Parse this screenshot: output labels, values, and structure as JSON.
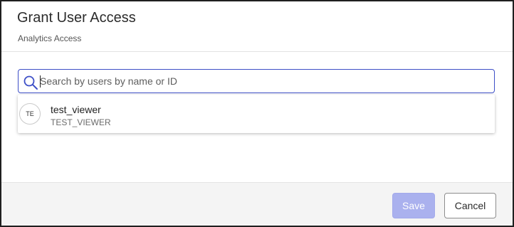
{
  "dialog": {
    "title": "Grant User Access",
    "subtitle": "Analytics Access"
  },
  "search": {
    "placeholder": "Search by users by name or ID",
    "value": "",
    "icon": "search-icon",
    "focus_color": "#3d4fc7"
  },
  "results": [
    {
      "initials": "TE",
      "name": "test_viewer",
      "id": "TEST_VIEWER"
    }
  ],
  "footer": {
    "save_label": "Save",
    "cancel_label": "Cancel",
    "save_color": "#aab1ee"
  }
}
